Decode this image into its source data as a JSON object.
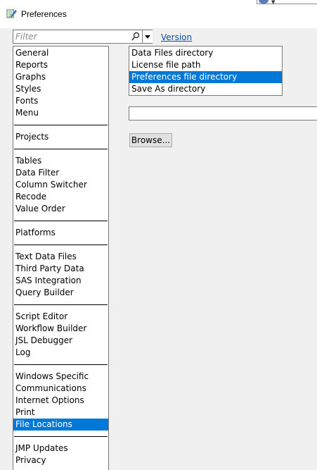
{
  "window": {
    "title": "Preferences",
    "title_icon": "jmp-app-icon"
  },
  "filter": {
    "placeholder": "Filter",
    "value": ""
  },
  "version_link": "Version",
  "categories": {
    "groups": [
      [
        "General",
        "Reports",
        "Graphs",
        "Styles",
        "Fonts",
        "Menu"
      ],
      [
        "Projects"
      ],
      [
        "Tables",
        "Data Filter",
        "Column Switcher",
        "Recode",
        "Value Order"
      ],
      [
        "Platforms"
      ],
      [
        "Text Data Files",
        "Third Party Data",
        "SAS Integration",
        "Query Builder"
      ],
      [
        "Script Editor",
        "Workflow Builder",
        "JSL Debugger",
        "Log"
      ],
      [
        "Windows Specific",
        "Communications",
        "Internet Options",
        "Print",
        "File Locations"
      ],
      [
        "JMP Updates",
        "Privacy"
      ]
    ],
    "selected": "File Locations"
  },
  "locations": {
    "items": [
      "Data Files directory",
      "License file path",
      "Preferences file directory",
      "Save As directory"
    ],
    "selected": "Preferences file directory"
  },
  "path": {
    "value": ""
  },
  "browse_label": "Browse...",
  "colors": {
    "selection": "#0078d7",
    "link": "#0a4ea3"
  }
}
